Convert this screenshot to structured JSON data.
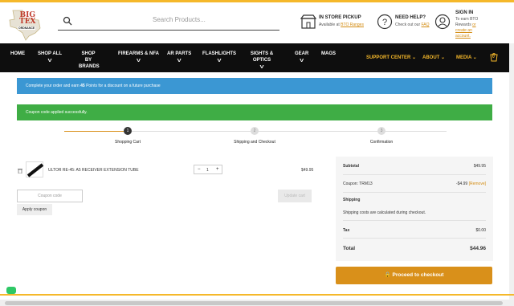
{
  "header": {
    "logo_line1": "BIG",
    "logo_line2": "TEX",
    "logo_line3": "ORDNANCE",
    "search_placeholder": "Search Products...",
    "pickup_title": "IN STORE PICKUP",
    "pickup_text": "Available at",
    "pickup_link": "BTO Ranges",
    "help_title": "NEED HELP?",
    "help_text": "Check out our",
    "help_link": "FAQ",
    "signin_title": "SIGN IN",
    "signin_text1": "To earn BTO Rewards",
    "signin_or": "or",
    "signin_link": "create an account."
  },
  "nav": {
    "items": [
      {
        "label": "HOME"
      },
      {
        "label": "SHOP ALL"
      },
      {
        "label": "SHOP BY BRANDS"
      },
      {
        "label": "FIREARMS & NFA"
      },
      {
        "label": "AR PARTS"
      },
      {
        "label": "FLASHLIGHTS"
      },
      {
        "label": "SIGHTS & OPTICS"
      },
      {
        "label": "GEAR"
      },
      {
        "label": "MAGS"
      },
      {
        "label": "SUPPORT CENTER"
      },
      {
        "label": "ABOUT"
      },
      {
        "label": "MEDIA"
      }
    ],
    "cart_count": "0"
  },
  "alerts": {
    "points_pre": "Complete your order and earn",
    "points_num": "45",
    "points_post": "Points for a discount on a future purchase",
    "coupon_success": "Coupon code applied successfully."
  },
  "steps": [
    {
      "num": "1",
      "label": "Shopping Cart"
    },
    {
      "num": "2",
      "label": "Shipping and Checkout"
    },
    {
      "num": "3",
      "label": "Confirmation"
    }
  ],
  "cart": {
    "product_name": "ULTOR RE-45: A5 RECEIVER EXTENSION TUBE",
    "qty": "1",
    "price": "$49.95",
    "coupon_placeholder": "Coupon code",
    "apply_label": "Apply coupon",
    "update_label": "Update cart"
  },
  "summary": {
    "subtotal_label": "Subtotal",
    "subtotal_value": "$49.95",
    "coupon_label": "Coupon: TRM13",
    "coupon_value": "-$4.99",
    "remove_label": "[Remove]",
    "shipping_label": "Shipping",
    "shipping_note": "Shipping costs are calculated during checkout.",
    "tax_label": "Tax",
    "tax_value": "$0.00",
    "total_label": "Total",
    "total_value": "$44.96",
    "checkout_label": "Proceed to checkout"
  },
  "colors": {
    "accent": "#f5b82a",
    "checkout": "#d9901a",
    "info": "#3b97d3",
    "success": "#3fad45",
    "nav_bg": "#0e0e0e"
  }
}
